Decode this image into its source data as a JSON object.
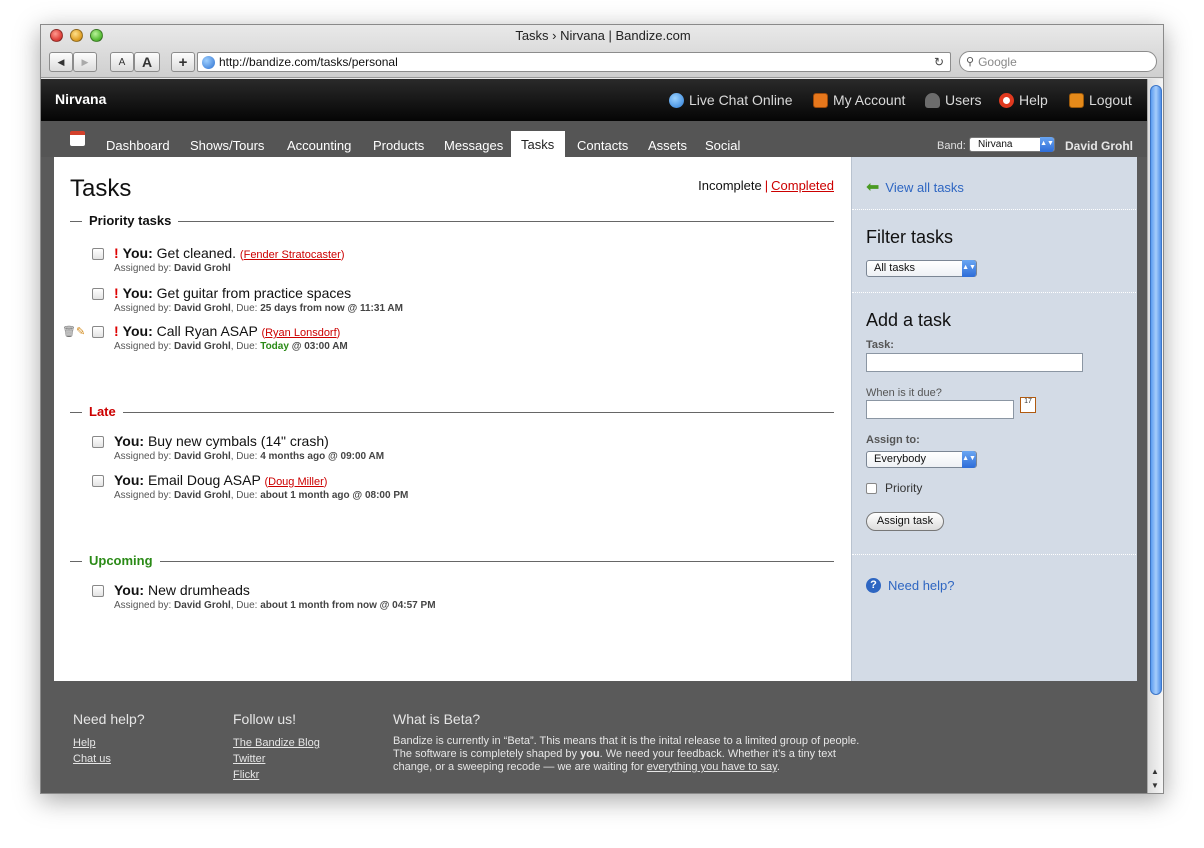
{
  "browser": {
    "window_title": "Tasks › Nirvana | Bandize.com",
    "back": "◀",
    "forward": "▶",
    "text_smaller": "A",
    "text_larger": "A",
    "add_bookmark": "+",
    "url": "http://bandize.com/tasks/personal",
    "reload": "↻",
    "search_placeholder": "Google"
  },
  "header": {
    "brand": "Nirvana",
    "links": [
      {
        "label": "Live Chat Online",
        "icon": "chat-bubble-icon"
      },
      {
        "label": "My Account",
        "icon": "account-card-icon"
      },
      {
        "label": "Users",
        "icon": "users-icon"
      },
      {
        "label": "Help",
        "icon": "lifebuoy-icon"
      },
      {
        "label": "Logout",
        "icon": "logout-door-icon"
      }
    ]
  },
  "nav": {
    "tabs": [
      "Dashboard",
      "Shows/Tours",
      "Accounting",
      "Products",
      "Messages",
      "Tasks",
      "Contacts",
      "Assets",
      "Social"
    ],
    "active": "Tasks",
    "band_label": "Band:",
    "band_value": "Nirvana",
    "user": "David Grohl"
  },
  "main": {
    "title": "Tasks",
    "filter_incomplete": "Incomplete",
    "filter_sep": "|",
    "filter_completed": "Completed",
    "sections": [
      {
        "title": "Priority tasks",
        "color": "#111111",
        "tasks": [
          {
            "priority": "!",
            "who": "You:",
            "text": "Get cleaned.",
            "ref": "Fender Stratocaster",
            "assigned_label": "Assigned by:",
            "assigned_by": "David Grohl",
            "due_label": "",
            "due": "",
            "due_time": ""
          },
          {
            "priority": "!",
            "who": "You:",
            "text": "Get guitar from practice spaces",
            "ref": "",
            "assigned_label": "Assigned by:",
            "assigned_by": "David Grohl",
            "due_label": ", Due:",
            "due": "25 days from now",
            "due_time": " @ 11:31 AM"
          },
          {
            "priority": "!",
            "who": "You:",
            "text": "Call Ryan ASAP",
            "ref": "Ryan Lonsdorf",
            "assigned_label": "Assigned by:",
            "assigned_by": "David Grohl",
            "due_label": ", Due:",
            "due": "Today",
            "due_time": " @ 03:00 AM"
          }
        ]
      },
      {
        "title": "Late",
        "color": "#cc0000",
        "tasks": [
          {
            "priority": "",
            "who": "You:",
            "text": "Buy new cymbals (14\" crash)",
            "ref": "",
            "assigned_label": "Assigned by:",
            "assigned_by": "David Grohl",
            "due_label": ", Due:",
            "due": "4 months ago",
            "due_time": " @ 09:00 AM"
          },
          {
            "priority": "",
            "who": "You:",
            "text": "Email Doug ASAP",
            "ref": "Doug Miller",
            "assigned_label": "Assigned by:",
            "assigned_by": "David Grohl",
            "due_label": ", Due:",
            "due": "about 1 month ago",
            "due_time": " @ 08:00 PM"
          }
        ]
      },
      {
        "title": "Upcoming",
        "color": "#2a8a16",
        "tasks": [
          {
            "priority": "",
            "who": "You:",
            "text": "New drumheads",
            "ref": "",
            "assigned_label": "Assigned by:",
            "assigned_by": "David Grohl",
            "due_label": ", Due:",
            "due": "about 1 month from now",
            "due_time": " @ 04:57 PM"
          }
        ]
      }
    ]
  },
  "sidebar": {
    "view_all": "View all tasks",
    "filter_title": "Filter tasks",
    "filter_value": "All tasks",
    "add_title": "Add a task",
    "task_label": "Task:",
    "task_value": "",
    "due_label": "When is it due?",
    "due_value": "",
    "calendar_day": "17",
    "assign_label": "Assign to:",
    "assign_value": "Everybody",
    "priority_label": "Priority",
    "assign_button": "Assign task",
    "need_help": "Need help?"
  },
  "footer": {
    "help_title": "Need help?",
    "help_links": [
      "Help",
      "Chat us"
    ],
    "follow_title": "Follow us!",
    "follow_links": [
      "The Bandize Blog",
      "Twitter",
      "Flickr"
    ],
    "beta_title": "What is Beta?",
    "beta_text_1": "Bandize is currently in “Beta”. This means that it is the inital release to a limited group of people. The software is completely shaped by ",
    "beta_text_you": "you",
    "beta_text_2": ". We need your feedback. Whether it’s a tiny text change, or a sweeping recode — we are waiting for ",
    "beta_link": "everything you have to say",
    "beta_text_3": "."
  },
  "colors": {
    "accent_link": "#2e66c2",
    "late_red": "#cc0000",
    "upcoming_green": "#2a8a16",
    "today_green": "#2a8a16",
    "sidebar_bg": "#d3dbe6"
  }
}
